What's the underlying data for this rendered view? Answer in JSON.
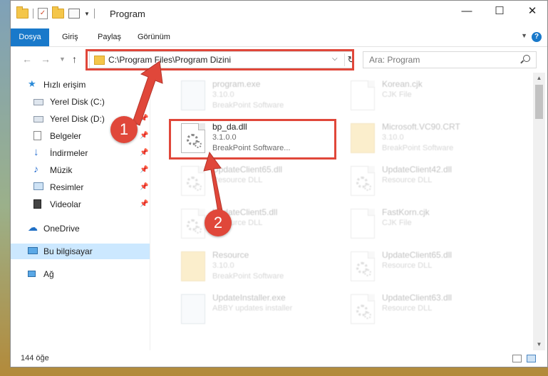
{
  "window": {
    "title": "Program"
  },
  "window_buttons": {
    "minimize": "—",
    "maximize": "☐",
    "close": "✕"
  },
  "ribbon": {
    "tabs": [
      "Dosya",
      "Giriş",
      "Paylaş",
      "Görünüm"
    ]
  },
  "address": {
    "path": "C:\\Program Files\\Program Dizini"
  },
  "search": {
    "placeholder": "Ara: Program"
  },
  "nav": {
    "quick_access": "Hızlı erişim",
    "items": [
      "Yerel Disk (C:)",
      "Yerel Disk (D:)",
      "Belgeler",
      "İndirmeler",
      "Müzik",
      "Resimler",
      "Videolar"
    ],
    "onedrive": "OneDrive",
    "this_pc": "Bu bilgisayar",
    "network": "Ağ"
  },
  "files": [
    {
      "name": "program.exe",
      "version": "3.10.0",
      "desc": "BreakPoint Software",
      "type": "exe"
    },
    {
      "name": "Korean.cjk",
      "version": "CJK File",
      "desc": "",
      "type": "doc"
    },
    {
      "name": "bp_da.dll",
      "version": "3.1.0.0",
      "desc": "BreakPoint Software...",
      "type": "dll"
    },
    {
      "name": "Microsoft.VC90.CRT",
      "version": "3.10.0",
      "desc": "BreakPoint Software",
      "type": "folder"
    },
    {
      "name": "UpdateClient65.dll",
      "version": "Resource DLL",
      "desc": "",
      "type": "dll"
    },
    {
      "name": "UpdateClient42.dll",
      "version": "Resource DLL",
      "desc": "",
      "type": "dll"
    },
    {
      "name": "UpdateClient5.dll",
      "version": "Resource DLL",
      "desc": "",
      "type": "dll"
    },
    {
      "name": "FastKorn.cjk",
      "version": "CJK File",
      "desc": "",
      "type": "doc"
    },
    {
      "name": "Resource",
      "version": "3.10.0",
      "desc": "BreakPoint Software",
      "type": "folder"
    },
    {
      "name": "UpdateClient65.dll",
      "version": "Resource DLL",
      "desc": "",
      "type": "dll"
    },
    {
      "name": "UpdateInstaller.exe",
      "version": "ABBY updates installer",
      "desc": "",
      "type": "exe"
    },
    {
      "name": "UpdateClient63.dll",
      "version": "Resource DLL",
      "desc": "",
      "type": "dll"
    }
  ],
  "status": {
    "count": "144 öğe"
  },
  "callouts": [
    "1",
    "2"
  ],
  "colors": {
    "accent": "#1979ca",
    "highlight": "#e0473a",
    "selected": "#cce8ff"
  }
}
